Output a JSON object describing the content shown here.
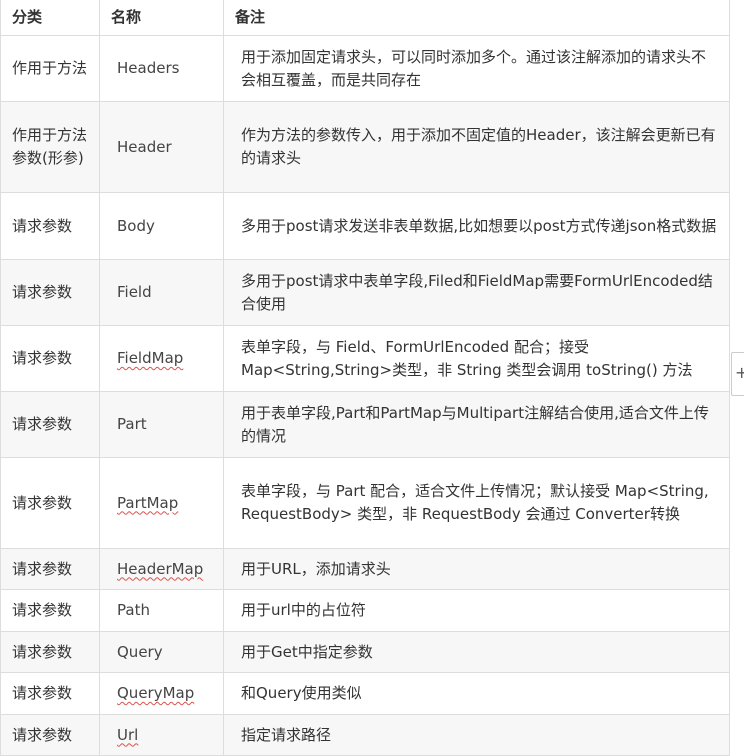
{
  "table": {
    "headers": [
      "分类",
      "名称",
      "备注"
    ],
    "rows": [
      {
        "category": "作用于方法",
        "name": "Headers",
        "note": "用于添加固定请求头，可以同时添加多个。通过该注解添加的请求头不会相互覆盖，而是共同存在"
      },
      {
        "category": "作用于方法参数(形参)",
        "name": "Header",
        "note": "作为方法的参数传入，用于添加不固定值的Header，该注解会更新已有的请求头"
      },
      {
        "category": "请求参数",
        "name": "Body",
        "note": "多用于post请求发送非表单数据,比如想要以post方式传递json格式数据"
      },
      {
        "category": "请求参数",
        "name": "Field",
        "note": "多用于post请求中表单字段,Filed和FieldMap需要FormUrlEncoded结合使用"
      },
      {
        "category": "请求参数",
        "name": "FieldMap",
        "note": "表单字段，与 Field、FormUrlEncoded 配合；接受 Map<String,String>类型，非 String 类型会调用 toString() 方法"
      },
      {
        "category": "请求参数",
        "name": "Part",
        "note": "用于表单字段,Part和PartMap与Multipart注解结合使用,适合文件上传的情况"
      },
      {
        "category": "请求参数",
        "name": "PartMap",
        "note": "表单字段，与 Part 配合，适合文件上传情况；默认接受 Map<String, RequestBody> 类型，非 RequestBody 会通过 Converter转换"
      },
      {
        "category": "请求参数",
        "name": "HeaderMap",
        "note": "用于URL，添加请求头"
      },
      {
        "category": "请求参数",
        "name": "Path",
        "note": "用于url中的占位符"
      },
      {
        "category": "请求参数",
        "name": "Query",
        "note": "用于Get中指定参数"
      },
      {
        "category": "请求参数",
        "name": "QueryMap",
        "note": "和Query使用类似"
      },
      {
        "category": "请求参数",
        "name": "Url",
        "note": "指定请求路径"
      }
    ]
  },
  "side_tab": {
    "icon": "plus-icon",
    "glyph": "+"
  }
}
